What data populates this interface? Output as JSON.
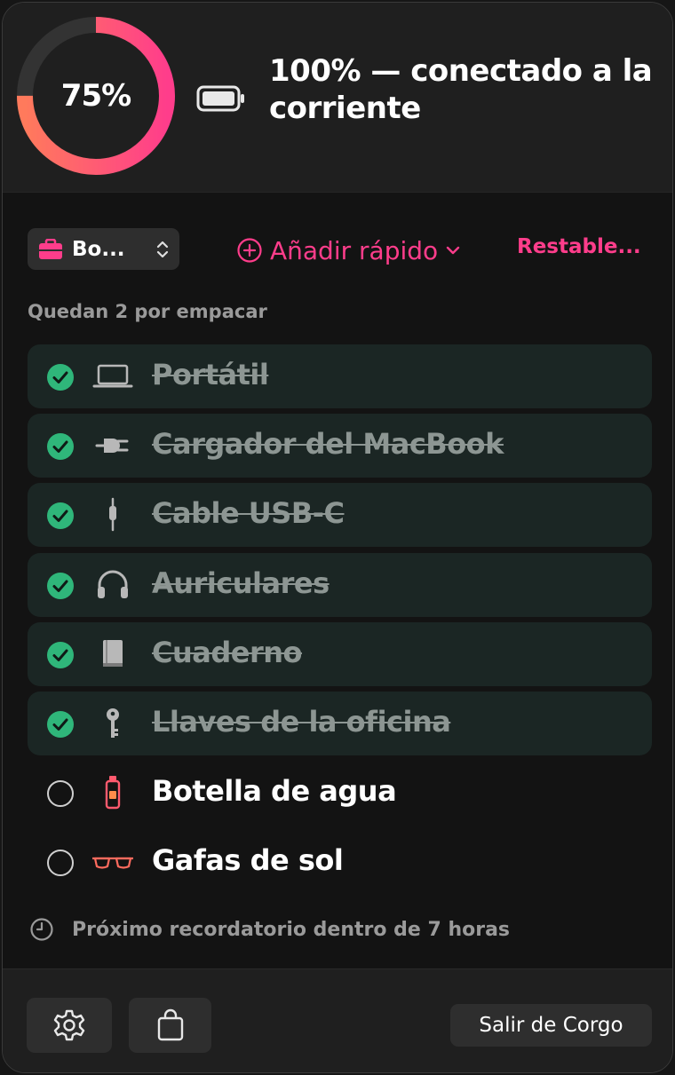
{
  "header": {
    "charge_progress": "75%",
    "charge_fraction": 0.75,
    "battery_status": "100% — conectado a la corriente"
  },
  "toolbar": {
    "bag_select_label": "Bo...",
    "quick_add_label": "Añadir rápido",
    "reset_label": "Restable..."
  },
  "remaining_text": "Quedan 2 por empacar",
  "items": [
    {
      "label": "Portátil",
      "icon": "laptop-icon",
      "done": true
    },
    {
      "label": "Cargador del MacBook",
      "icon": "plug-icon",
      "done": true
    },
    {
      "label": "Cable USB-C",
      "icon": "cable-icon",
      "done": true
    },
    {
      "label": "Auriculares",
      "icon": "headphones-icon",
      "done": true
    },
    {
      "label": "Cuaderno",
      "icon": "book-icon",
      "done": true
    },
    {
      "label": "Llaves de la oficina",
      "icon": "key-icon",
      "done": true
    },
    {
      "label": "Botella de agua",
      "icon": "bottle-icon",
      "done": false
    },
    {
      "label": "Gafas de sol",
      "icon": "sunglasses-icon",
      "done": false
    }
  ],
  "reminder_text": "Próximo recordatorio dentro de 7 horas",
  "footer": {
    "quit_label": "Salir de Corgo"
  },
  "colors": {
    "accent": "#ff3d8b",
    "ring_start": "#ff7a5c",
    "ring_end": "#ff3d8b",
    "check": "#2fb67a"
  }
}
